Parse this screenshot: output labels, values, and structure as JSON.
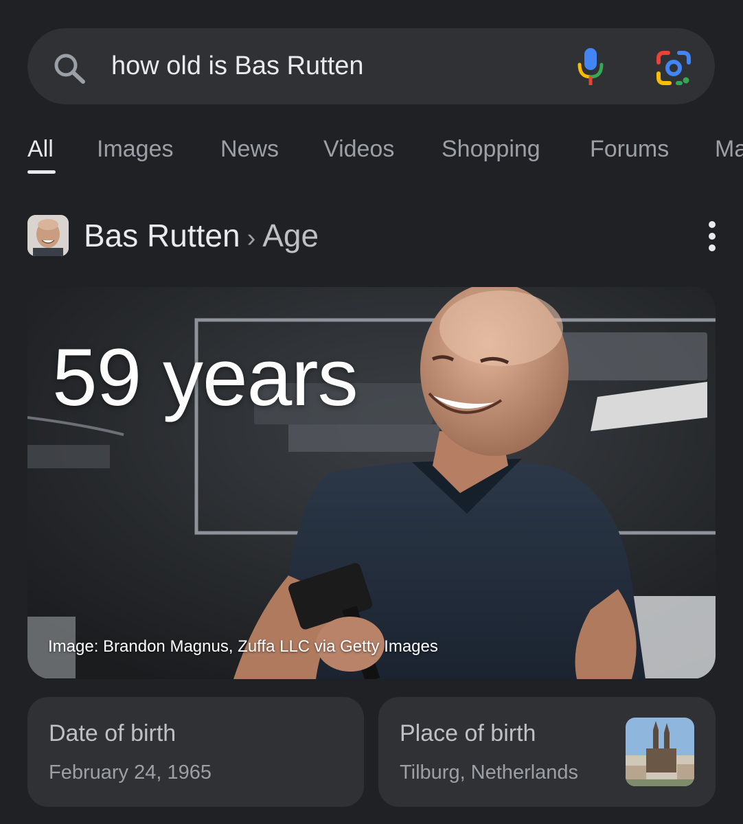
{
  "search": {
    "query": "how old is Bas Rutten",
    "icons": [
      "search-icon",
      "mic-icon",
      "lens-icon"
    ]
  },
  "tabs": [
    {
      "label": "All",
      "active": true
    },
    {
      "label": "Images",
      "active": false
    },
    {
      "label": "News",
      "active": false
    },
    {
      "label": "Videos",
      "active": false
    },
    {
      "label": "Shopping",
      "active": false
    },
    {
      "label": "Forums",
      "active": false
    },
    {
      "label": "Ma",
      "active": false
    }
  ],
  "entity": {
    "name": "Bas Rutten",
    "separator": "›",
    "attribute": "Age"
  },
  "hero": {
    "age": "59 years",
    "credit": "Image: Brandon Magnus, Zuffa LLC via Getty Images"
  },
  "facts": {
    "birth_date": {
      "label": "Date of birth",
      "value": "February 24, 1965"
    },
    "birth_place": {
      "label": "Place of birth",
      "value": "Tilburg, Netherlands"
    }
  },
  "colors": {
    "background": "#202124",
    "surface": "#303134",
    "text_primary": "#e8eaed",
    "text_secondary": "#9aa0a6"
  }
}
